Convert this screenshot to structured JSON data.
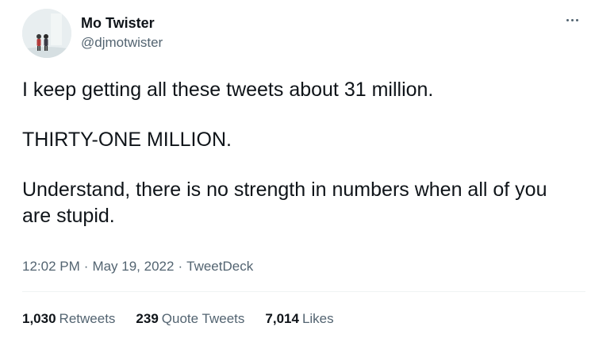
{
  "author": {
    "name": "Mo Twister",
    "handle": "@djmotwister",
    "avatar_icon": "profile-photo-two-people-in-mist"
  },
  "menu": {
    "icon": "more-horizontal-icon"
  },
  "tweet": {
    "paragraphs": [
      "I keep getting all these tweets about 31 million.",
      "THIRTY-ONE MILLION.",
      "Understand, there is no strength in numbers when all of you are stupid."
    ],
    "time": "12:02 PM",
    "date": "May 19, 2022",
    "source": "TweetDeck",
    "separator": "·"
  },
  "stats": {
    "retweets_count": "1,030",
    "retweets_label": "Retweets",
    "quotes_count": "239",
    "quotes_label": "Quote Tweets",
    "likes_count": "7,014",
    "likes_label": "Likes"
  },
  "colors": {
    "text_primary": "#0f1419",
    "text_secondary": "#536471",
    "divider": "#eff3f4"
  }
}
